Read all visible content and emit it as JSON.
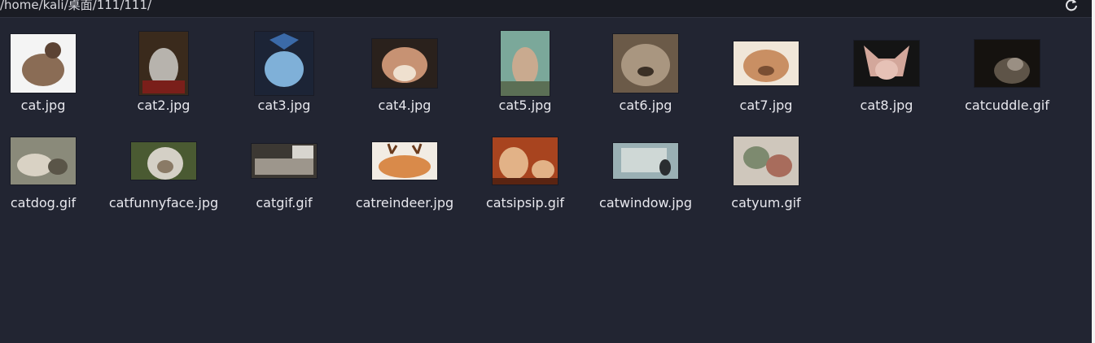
{
  "location": {
    "path": "/home/kali/桌面/111/111/"
  },
  "files": [
    {
      "name": "cat.jpg",
      "colors": [
        "#f4f4f4",
        "#8a6c55",
        "#5c4334"
      ]
    },
    {
      "name": "cat2.jpg",
      "colors": [
        "#3a2a1c",
        "#b7b3ad",
        "#7a1f1a"
      ]
    },
    {
      "name": "cat3.jpg",
      "colors": [
        "#1c2436",
        "#7fb0d8",
        "#3b6aa8"
      ]
    },
    {
      "name": "cat4.jpg",
      "colors": [
        "#2a211c",
        "#c79273",
        "#efe0cf"
      ]
    },
    {
      "name": "cat5.jpg",
      "colors": [
        "#7ba89a",
        "#c9aa8f",
        "#5b6f55"
      ]
    },
    {
      "name": "cat6.jpg",
      "colors": [
        "#6b5a48",
        "#a99680",
        "#3b3026"
      ]
    },
    {
      "name": "cat7.jpg",
      "colors": [
        "#f0e6d8",
        "#c98f63",
        "#7a4f33"
      ]
    },
    {
      "name": "cat8.jpg",
      "colors": [
        "#141414",
        "#d3a79b",
        "#e6c1b6"
      ]
    },
    {
      "name": "catcuddle.gif",
      "colors": [
        "#15120f",
        "#5e5448",
        "#9a8f83"
      ]
    },
    {
      "name": "catdog.gif",
      "colors": [
        "#8a8a7a",
        "#d9d2c4",
        "#5a5548"
      ]
    },
    {
      "name": "catfunnyface.jpg",
      "colors": [
        "#4a5a32",
        "#d4d0c6",
        "#8a7a66"
      ]
    },
    {
      "name": "catgif.gif",
      "colors": [
        "#3c3833",
        "#9d968c",
        "#d8d5cf"
      ]
    },
    {
      "name": "catreindeer.jpg",
      "colors": [
        "#f2ece4",
        "#d98a4a",
        "#6b3b1d"
      ]
    },
    {
      "name": "catsipsip.gif",
      "colors": [
        "#a8441f",
        "#e2b287",
        "#5a2412"
      ]
    },
    {
      "name": "catwindow.jpg",
      "colors": [
        "#9ab0b4",
        "#cfd8d6",
        "#2a2d30"
      ]
    },
    {
      "name": "catyum.gif",
      "colors": [
        "#cfc7bc",
        "#7d8a6f",
        "#a86c5c"
      ]
    }
  ]
}
